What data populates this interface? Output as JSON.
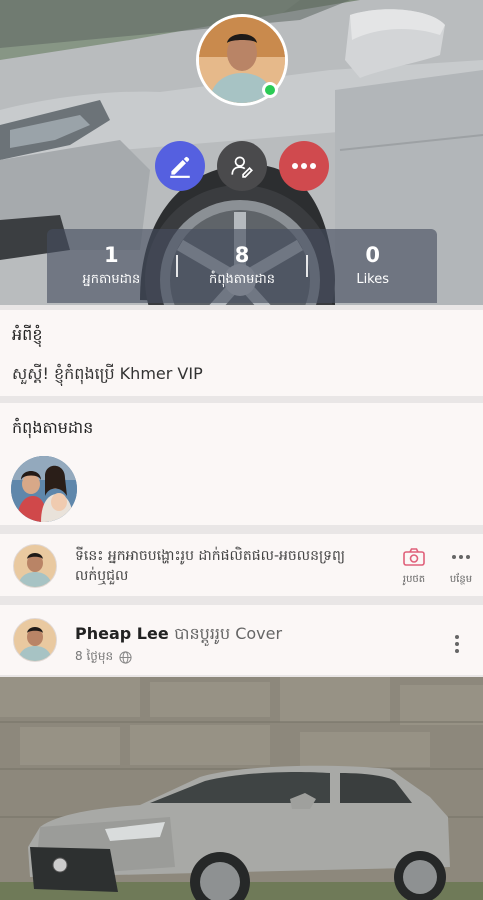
{
  "profile": {
    "online": true
  },
  "actions": {
    "edit_icon": "pencil-icon",
    "profile_icon": "user-edit-icon",
    "more_icon": "more-dots-icon"
  },
  "stats": [
    {
      "value": "1",
      "label": "អ្នកតាមដាន"
    },
    {
      "value": "8",
      "label": "កំពុងតាមដាន"
    },
    {
      "value": "0",
      "label": "Likes"
    }
  ],
  "about": {
    "title": "អំពីខ្ញុំ",
    "text": "សួស្តី! ខ្ញុំកំពុងប្រើ Khmer VIP"
  },
  "following_section": {
    "title": "កំពុងតាមដាន"
  },
  "composer": {
    "prompt": "ទីនេះ អ្នកអាចបង្ហោះរូប ដាក់ផលិតផល-អចលនទ្រព្យ លក់ឬជួល",
    "photo_label": "រូបថត",
    "more_label": "បន្ថែម"
  },
  "post": {
    "author": "Pheap Lee",
    "action": "បានប្តូររូប Cover",
    "time": "8 ថ្ងៃមុន",
    "privacy_icon": "globe-icon"
  },
  "colors": {
    "edit_button": "#5560e0",
    "profile_button": "#4a4a4c",
    "more_button": "#d04a4e",
    "online": "#2bcb55"
  }
}
